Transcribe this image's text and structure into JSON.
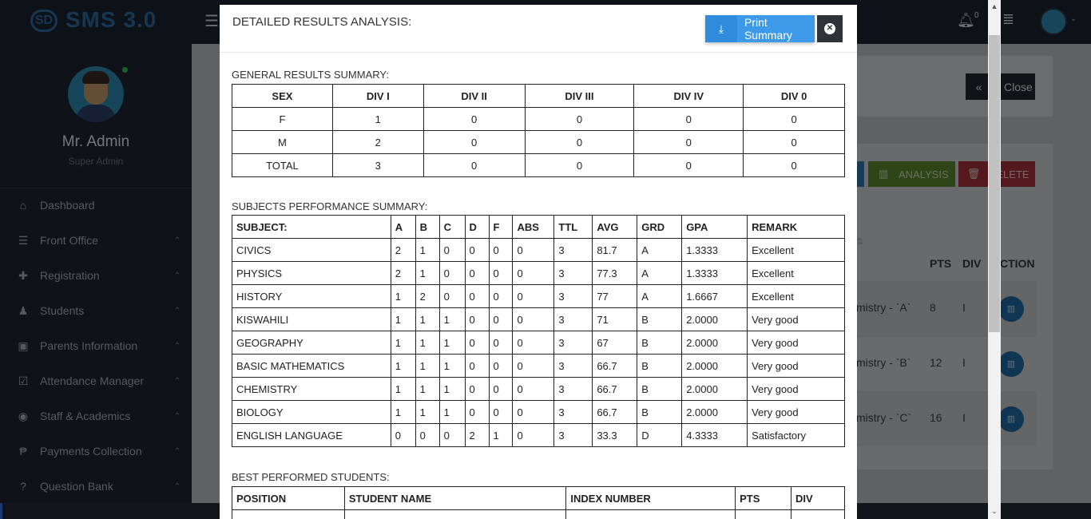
{
  "app": {
    "logo_mark": "SD",
    "logo_text": "SMS 3.0",
    "notification_count": "0"
  },
  "profile": {
    "name": "Mr. Admin",
    "role": "Super Admin"
  },
  "sidebar": {
    "items": [
      {
        "label": "Dashboard",
        "icon": "home-icon",
        "glyph": "⌂",
        "has_caret": false
      },
      {
        "label": "Front Office",
        "icon": "bars-icon",
        "glyph": "☰",
        "has_caret": true
      },
      {
        "label": "Registration",
        "icon": "user-plus-icon",
        "glyph": "✚",
        "has_caret": true
      },
      {
        "label": "Students",
        "icon": "users-icon",
        "glyph": "♟",
        "has_caret": true
      },
      {
        "label": "Parents Information",
        "icon": "address-book-icon",
        "glyph": "▣",
        "has_caret": true
      },
      {
        "label": "Attendance Manager",
        "icon": "calendar-check-icon",
        "glyph": "☑",
        "has_caret": true
      },
      {
        "label": "Staff & Academics",
        "icon": "graduation-icon",
        "glyph": "◉",
        "has_caret": true
      },
      {
        "label": "Payments Collection",
        "icon": "paypal-icon",
        "glyph": "₱",
        "has_caret": true
      },
      {
        "label": "Question Bank",
        "icon": "question-circle-icon",
        "glyph": "?",
        "has_caret": true
      }
    ]
  },
  "background": {
    "close_label": "Close",
    "analysis_label": "ANALYSIS",
    "delete_label": "DELETE",
    "table_headers": {
      "pts": "PTS",
      "div": "DIV",
      "action": "CTION"
    },
    "rows": [
      {
        "name": "mistry - `A`",
        "pts": "8",
        "div": "I"
      },
      {
        "name": "mistry - `B`",
        "pts": "12",
        "div": "I"
      },
      {
        "name": "mistry - `C`",
        "pts": "16",
        "div": "I"
      }
    ]
  },
  "modal": {
    "title": "DETAILED RESULTS ANALYSIS:",
    "print_label": "Print Summary",
    "general": {
      "title": "GENERAL RESULTS SUMMARY:",
      "headers": [
        "SEX",
        "DIV I",
        "DIV II",
        "DIV III",
        "DIV IV",
        "DIV 0"
      ],
      "rows": [
        [
          "F",
          "1",
          "0",
          "0",
          "0",
          "0"
        ],
        [
          "M",
          "2",
          "0",
          "0",
          "0",
          "0"
        ],
        [
          "TOTAL",
          "3",
          "0",
          "0",
          "0",
          "0"
        ]
      ]
    },
    "subjects": {
      "title": "SUBJECTS PERFORMANCE SUMMARY:",
      "headers": [
        "SUBJECT:",
        "A",
        "B",
        "C",
        "D",
        "F",
        "ABS",
        "TTL",
        "AVG",
        "GRD",
        "GPA",
        "REMARK"
      ],
      "rows": [
        [
          "CIVICS",
          "2",
          "1",
          "0",
          "0",
          "0",
          "0",
          "3",
          "81.7",
          "A",
          "1.3333",
          "Excellent"
        ],
        [
          "PHYSICS",
          "2",
          "1",
          "0",
          "0",
          "0",
          "0",
          "3",
          "77.3",
          "A",
          "1.3333",
          "Excellent"
        ],
        [
          "HISTORY",
          "1",
          "2",
          "0",
          "0",
          "0",
          "0",
          "3",
          "77",
          "A",
          "1.6667",
          "Excellent"
        ],
        [
          "KISWAHILI",
          "1",
          "1",
          "1",
          "0",
          "0",
          "0",
          "3",
          "71",
          "B",
          "2.0000",
          "Very good"
        ],
        [
          "GEOGRAPHY",
          "1",
          "1",
          "1",
          "0",
          "0",
          "0",
          "3",
          "67",
          "B",
          "2.0000",
          "Very good"
        ],
        [
          "BASIC MATHEMATICS",
          "1",
          "1",
          "1",
          "0",
          "0",
          "0",
          "3",
          "66.7",
          "B",
          "2.0000",
          "Very good"
        ],
        [
          "CHEMISTRY",
          "1",
          "1",
          "1",
          "0",
          "0",
          "0",
          "3",
          "66.7",
          "B",
          "2.0000",
          "Very good"
        ],
        [
          "BIOLOGY",
          "1",
          "1",
          "1",
          "0",
          "0",
          "0",
          "3",
          "66.7",
          "B",
          "2.0000",
          "Very good"
        ],
        [
          "ENGLISH LANGUAGE",
          "0",
          "0",
          "0",
          "2",
          "1",
          "0",
          "3",
          "33.3",
          "D",
          "4.3333",
          "Satisfactory"
        ]
      ]
    },
    "best": {
      "title": "BEST PERFORMED STUDENTS:",
      "headers": [
        "POSITION",
        "STUDENT NAME",
        "INDEX NUMBER",
        "PTS",
        "DIV"
      ]
    }
  }
}
